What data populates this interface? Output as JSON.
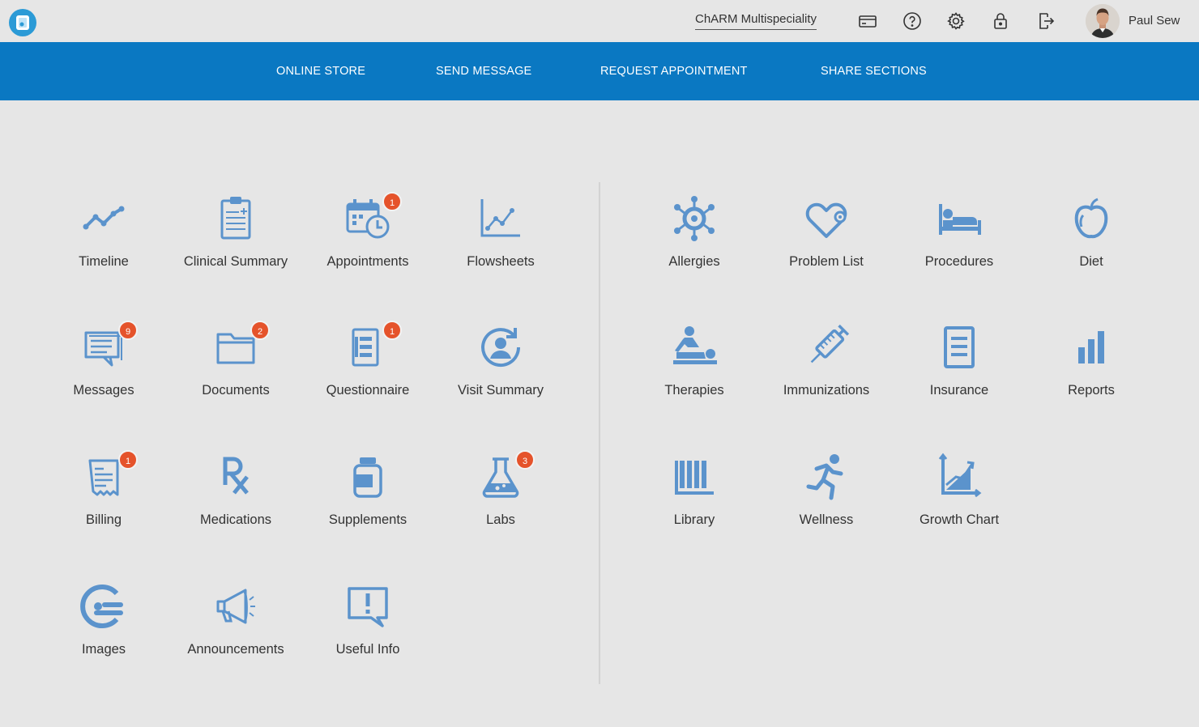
{
  "header": {
    "practice_name": "ChARM Multispeciality",
    "user_name": "Paul Sew",
    "icons": [
      "card-icon",
      "help-icon",
      "gear-icon",
      "lock-icon",
      "logout-icon"
    ]
  },
  "nav": {
    "items": [
      "ONLINE STORE",
      "SEND MESSAGE",
      "REQUEST APPOINTMENT",
      "SHARE SECTIONS"
    ]
  },
  "colors": {
    "accent": "#0a78c2",
    "icon": "#5b93cc",
    "badge": "#e5532b"
  },
  "tiles": {
    "timeline": {
      "label": "Timeline"
    },
    "clinical_summary": {
      "label": "Clinical Summary"
    },
    "appointments": {
      "label": "Appointments",
      "badge": "1"
    },
    "flowsheets": {
      "label": "Flowsheets"
    },
    "messages": {
      "label": "Messages",
      "badge": "9"
    },
    "documents": {
      "label": "Documents",
      "badge": "2"
    },
    "questionnaire": {
      "label": "Questionnaire",
      "badge": "1"
    },
    "visit_summary": {
      "label": "Visit Summary"
    },
    "billing": {
      "label": "Billing",
      "badge": "1"
    },
    "medications": {
      "label": "Medications"
    },
    "supplements": {
      "label": "Supplements"
    },
    "labs": {
      "label": "Labs",
      "badge": "3"
    },
    "images": {
      "label": "Images"
    },
    "announcements": {
      "label": "Announcements"
    },
    "useful_info": {
      "label": "Useful Info"
    },
    "allergies": {
      "label": "Allergies"
    },
    "problem_list": {
      "label": "Problem List"
    },
    "procedures": {
      "label": "Procedures"
    },
    "diet": {
      "label": "Diet"
    },
    "therapies": {
      "label": "Therapies"
    },
    "immunizations": {
      "label": "Immunizations"
    },
    "insurance": {
      "label": "Insurance"
    },
    "reports": {
      "label": "Reports"
    },
    "library": {
      "label": "Library"
    },
    "wellness": {
      "label": "Wellness"
    },
    "growth_chart": {
      "label": "Growth Chart"
    }
  }
}
